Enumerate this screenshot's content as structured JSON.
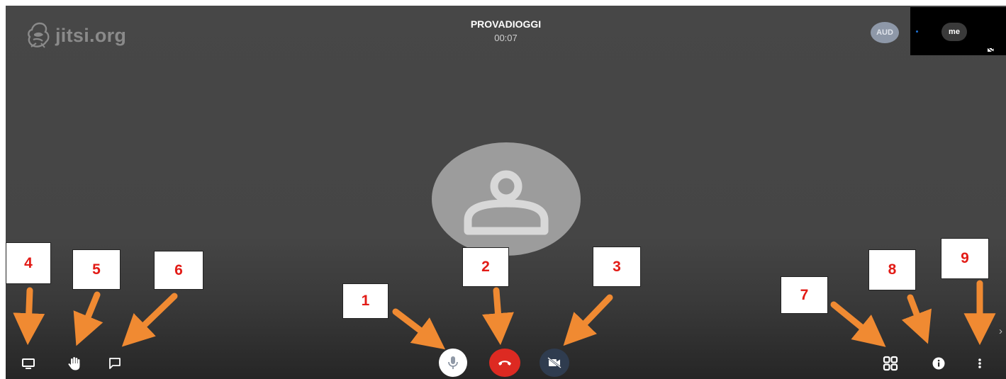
{
  "brand": {
    "logo_text": "jitsi.org",
    "logo_icon": "jitsi-logo-icon"
  },
  "meeting": {
    "room_name": "PROVADIOGGI",
    "elapsed": "00:07"
  },
  "participants": {
    "remote_avatar_initials": "AUD",
    "local_label": "me",
    "local_status_icon": "camera-off-icon",
    "main_avatar_icon": "default-user-avatar-icon"
  },
  "toolbar": {
    "left": [
      {
        "id": "screen-share",
        "icon": "desktop-icon"
      },
      {
        "id": "raise-hand",
        "icon": "hand-icon"
      },
      {
        "id": "chat",
        "icon": "chat-bubble-icon"
      }
    ],
    "center": [
      {
        "id": "microphone",
        "icon": "microphone-icon",
        "color": "#ffffff"
      },
      {
        "id": "hangup",
        "icon": "phone-hangup-icon",
        "color": "#dd2a22"
      },
      {
        "id": "camera",
        "icon": "camera-off-icon",
        "color": "#2f3c4f"
      }
    ],
    "right": [
      {
        "id": "tile-view",
        "icon": "grid-icon"
      },
      {
        "id": "info",
        "icon": "info-icon"
      },
      {
        "id": "more",
        "icon": "more-vertical-icon"
      }
    ],
    "expand_icon": "chevron-right-icon",
    "expand_glyph": "›"
  },
  "annotations": {
    "box_labels": [
      "1",
      "2",
      "3",
      "4",
      "5",
      "6",
      "7",
      "8",
      "9"
    ],
    "box_color": "#e21b16",
    "arrow_color": "#f08a32"
  }
}
